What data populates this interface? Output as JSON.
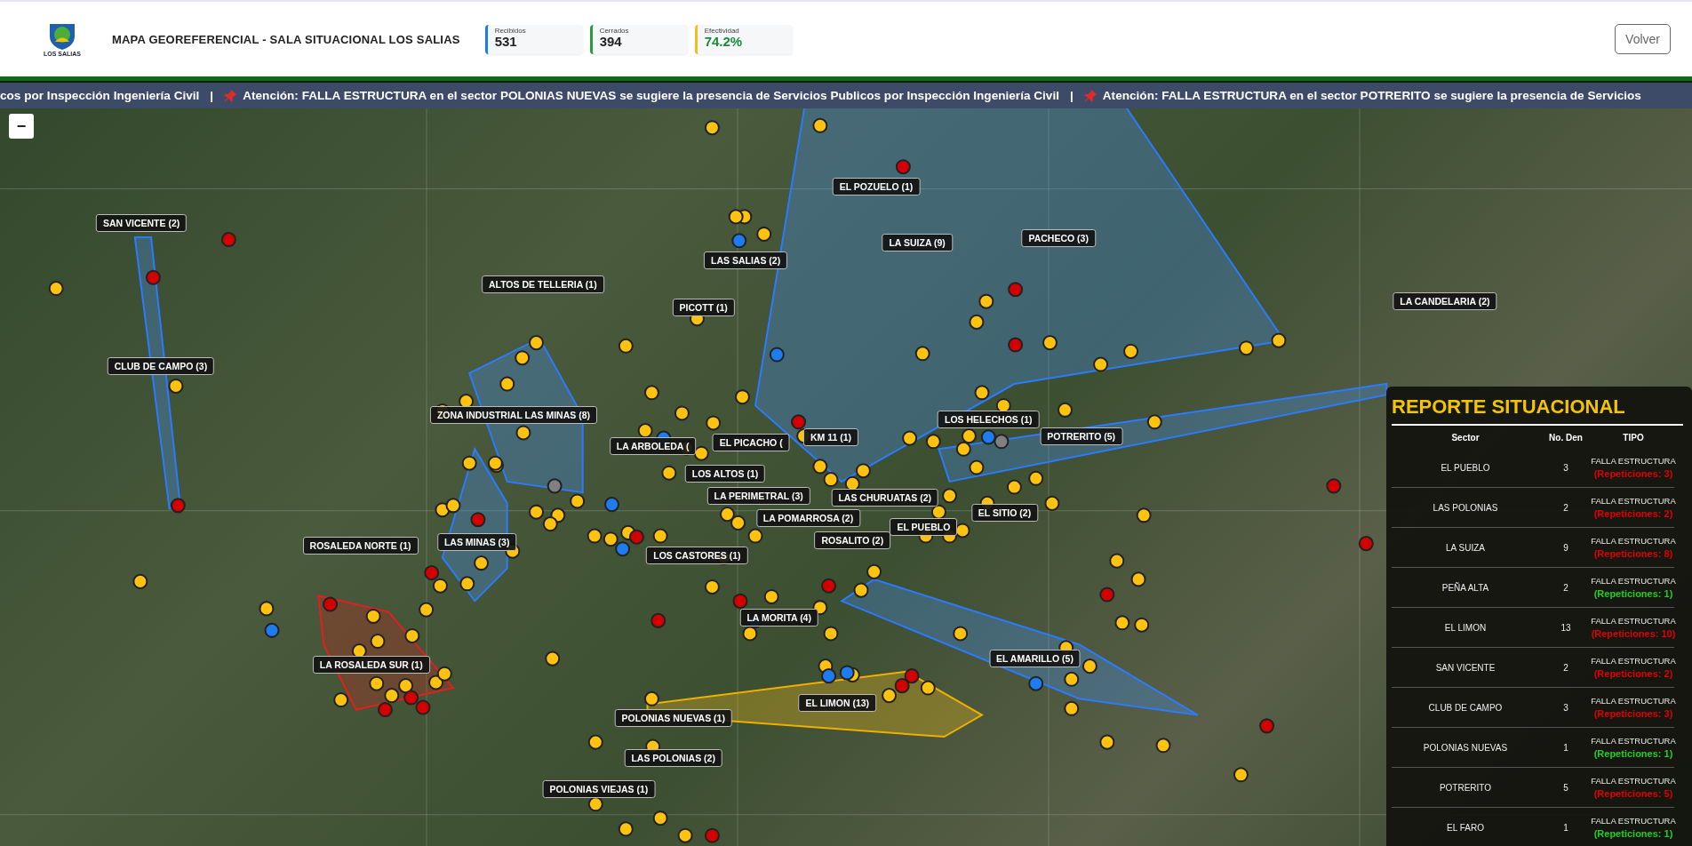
{
  "header": {
    "logo_text": "LOS SALIAS",
    "title": "MAPA GEOREFERENCIAL - SALA SITUACIONAL LOS SALIAS",
    "stats": [
      {
        "label": "Recibidos",
        "value": "531",
        "kind": "received"
      },
      {
        "label": "Cerrados",
        "value": "394",
        "kind": "closed"
      },
      {
        "label": "Efectividad",
        "value": "74.2%",
        "kind": "rate"
      }
    ],
    "back_button": "Volver"
  },
  "ticker": {
    "separator": "|",
    "segments": [
      {
        "pinned": false,
        "text": "cos por Inspección Ingeniería Civil"
      },
      {
        "pinned": true,
        "text": "Atención: FALLA ESTRUCTURA en el sector POLONIAS NUEVAS se sugiere la presencia de Servicios Publicos por Inspección Ingeniería Civil"
      },
      {
        "pinned": true,
        "text": "Atención: FALLA ESTRUCTURA en el sector POTRERITO se sugiere la presencia de Servicios"
      }
    ]
  },
  "map": {
    "zoom_button": "−",
    "labels": [
      "SAN VICENTE (2)",
      "ALTOS DE TELLERIA (1)",
      "EL POZUELO (1)",
      "LA SUIZA (9)",
      "PACHECO (3)",
      "LAS SALIAS (2)",
      "PICOTT (1)",
      "LA CANDELARIA (2)",
      "CLUB DE CAMPO (3)",
      "ZONA INDUSTRIAL LAS MINAS (8)",
      "LOS HELECHOS (1)",
      "POTRERITO (5)",
      "LA ARBOLEDA (",
      "EL PICACHO (",
      "KM 11 (1)",
      "LOS ALTOS (1)",
      "LA PERIMETRAL (3)",
      "LAS CHURUATAS (2)",
      "EL SITIO (2)",
      "EL PUEBLO",
      "LA POMARROSA (2)",
      "ROSALITO (2)",
      "ROSALEDA NORTE (1)",
      "LAS MINAS (3)",
      "LOS CASTORES (1)",
      "LA MORITA (4)",
      "LA ROSALEDA SUR (1)",
      "EL AMARILLO (5)",
      "EL LIMON (13)",
      "POLONIAS NUEVAS (1)",
      "LAS POLONIAS (2)",
      "POLONIAS VIEJAS (1)"
    ]
  },
  "report": {
    "title": "REPORTE SITUACIONAL",
    "columns": [
      "Sector",
      "No. Den",
      "TIPO"
    ],
    "rows": [
      {
        "sector": "EL PUEBLO",
        "count": "3",
        "type": "FALLA ESTRUCTURA",
        "repeats": "(Repeticiones: 3)",
        "color": "#e00000"
      },
      {
        "sector": "LAS POLONIAS",
        "count": "2",
        "type": "FALLA ESTRUCTURA",
        "repeats": "(Repeticiones: 2)",
        "color": "#e00000"
      },
      {
        "sector": "LA SUIZA",
        "count": "9",
        "type": "FALLA ESTRUCTURA",
        "repeats": "(Repeticiones: 8)",
        "color": "#e00000"
      },
      {
        "sector": "PEÑA ALTA",
        "count": "2",
        "type": "FALLA ESTRUCTURA",
        "repeats": "(Repeticiones: 1)",
        "color": "#22cc22"
      },
      {
        "sector": "EL LIMON",
        "count": "13",
        "type": "FALLA ESTRUCTURA",
        "repeats": "(Repeticiones: 10)",
        "color": "#e00000"
      },
      {
        "sector": "SAN VICENTE",
        "count": "2",
        "type": "FALLA ESTRUCTURA",
        "repeats": "(Repeticiones: 2)",
        "color": "#e00000"
      },
      {
        "sector": "CLUB DE CAMPO",
        "count": "3",
        "type": "FALLA ESTRUCTURA",
        "repeats": "(Repeticiones: 3)",
        "color": "#e00000"
      },
      {
        "sector": "POLONIAS NUEVAS",
        "count": "1",
        "type": "FALLA ESTRUCTURA",
        "repeats": "(Repeticiones: 1)",
        "color": "#22cc22"
      },
      {
        "sector": "POTRERITO",
        "count": "5",
        "type": "FALLA ESTRUCTURA",
        "repeats": "(Repeticiones: 5)",
        "color": "#e00000"
      },
      {
        "sector": "EL FARO",
        "count": "1",
        "type": "FALLA ESTRUCTURA",
        "repeats": "(Repeticiones: 1)",
        "color": "#22cc22"
      }
    ]
  }
}
